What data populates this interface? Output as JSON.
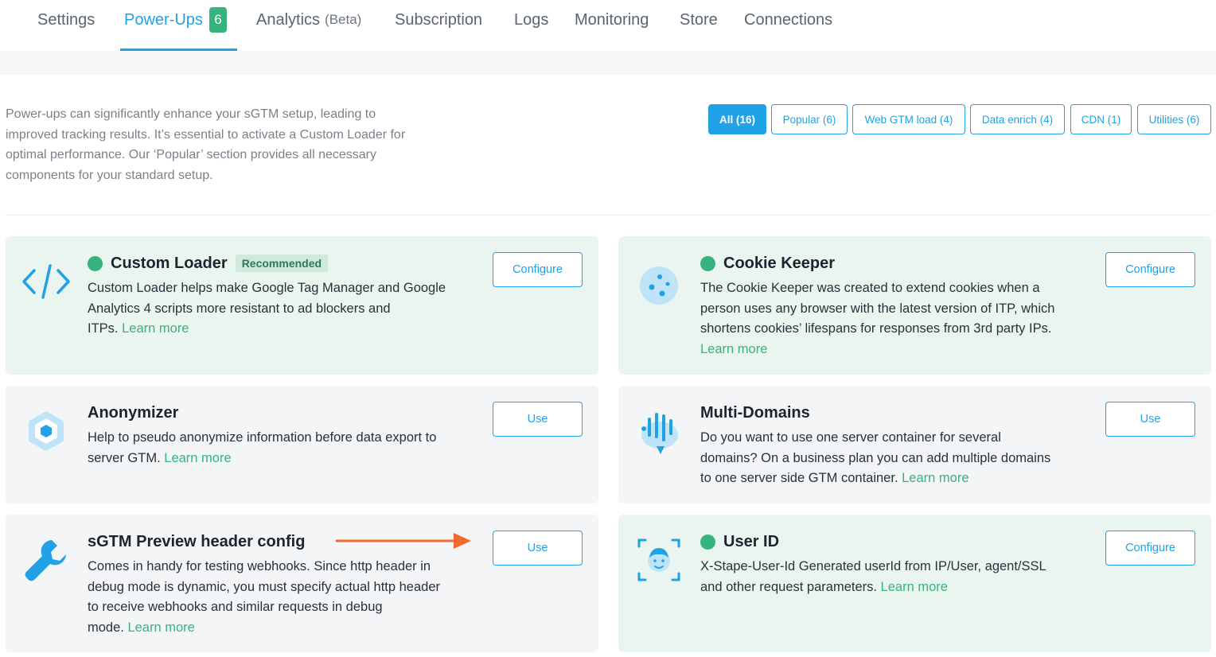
{
  "tabs": [
    {
      "label": "Settings"
    },
    {
      "label": "Power-Ups",
      "count": "6"
    },
    {
      "label": "Analytics",
      "sub": "(Beta)"
    },
    {
      "label": "Subscription"
    },
    {
      "label": "Logs"
    },
    {
      "label": "Monitoring"
    },
    {
      "label": "Store"
    },
    {
      "label": "Connections"
    }
  ],
  "intro": {
    "lines": [
      "Power-ups can significantly enhance your sGTM setup, leading to",
      "improved tracking results. It’s essential to activate a Custom Loader for",
      "optimal performance. Our ‘Popular’ section provides all necessary",
      "components for your standard setup."
    ]
  },
  "filters": [
    {
      "label": "All (16)"
    },
    {
      "label": "Popular (6)"
    },
    {
      "label": "Web GTM load (4)"
    },
    {
      "label": "Data enrich (4)"
    },
    {
      "label": "CDN (1)"
    },
    {
      "label": "Utilities (6)"
    }
  ],
  "cards": [
    {
      "title": "Custom Loader",
      "badge": "Recommended",
      "desc_lines": [
        "Custom Loader helps make Google Tag Manager and Google",
        "Analytics 4 scripts more resistant to ad blockers and",
        "ITPs. "
      ],
      "learn": "Learn more",
      "button": "Configure",
      "icon": "code-icon",
      "status": "active"
    },
    {
      "title": "Cookie Keeper",
      "desc_lines": [
        "The Cookie Keeper was created to extend cookies when a",
        "person uses any browser with the latest version of ITP, which",
        "shortens cookies’ lifespans for responses from 3rd party IPs.",
        ""
      ],
      "learn": "Learn more",
      "button": "Configure",
      "icon": "cookie-icon",
      "status": "active"
    },
    {
      "title": "Anonymizer",
      "desc_lines": [
        "Help to pseudo anonymize information before data export to",
        "server GTM. "
      ],
      "learn": "Learn more",
      "button": "Use",
      "icon": "hexagon-icon"
    },
    {
      "title": "Multi-Domains",
      "desc_lines": [
        "Do you want to use one server container for several",
        "domains? On a business plan you can add multiple domains",
        "to one server side GTM container. "
      ],
      "learn": "Learn more",
      "button": "Use",
      "icon": "domains-icon"
    },
    {
      "title": "sGTM Preview header config",
      "desc_lines": [
        "Comes in handy for testing webhooks. Since http header in",
        "debug mode is dynamic, you must specify actual http header",
        "to receive webhooks and similar requests in debug",
        "mode. "
      ],
      "learn": "Learn more",
      "button": "Use",
      "icon": "wrench-icon"
    },
    {
      "title": "User ID",
      "desc_lines": [
        "X-Stape-User-Id Generated userId from IP/User, agent/SSL",
        "and other request parameters. "
      ],
      "learn": "Learn more",
      "button": "Configure",
      "icon": "user-scan-icon",
      "status": "active"
    }
  ],
  "colors": {
    "accent": "#22a2e6",
    "green": "#36b37e",
    "arrow": "#f26a2e"
  }
}
